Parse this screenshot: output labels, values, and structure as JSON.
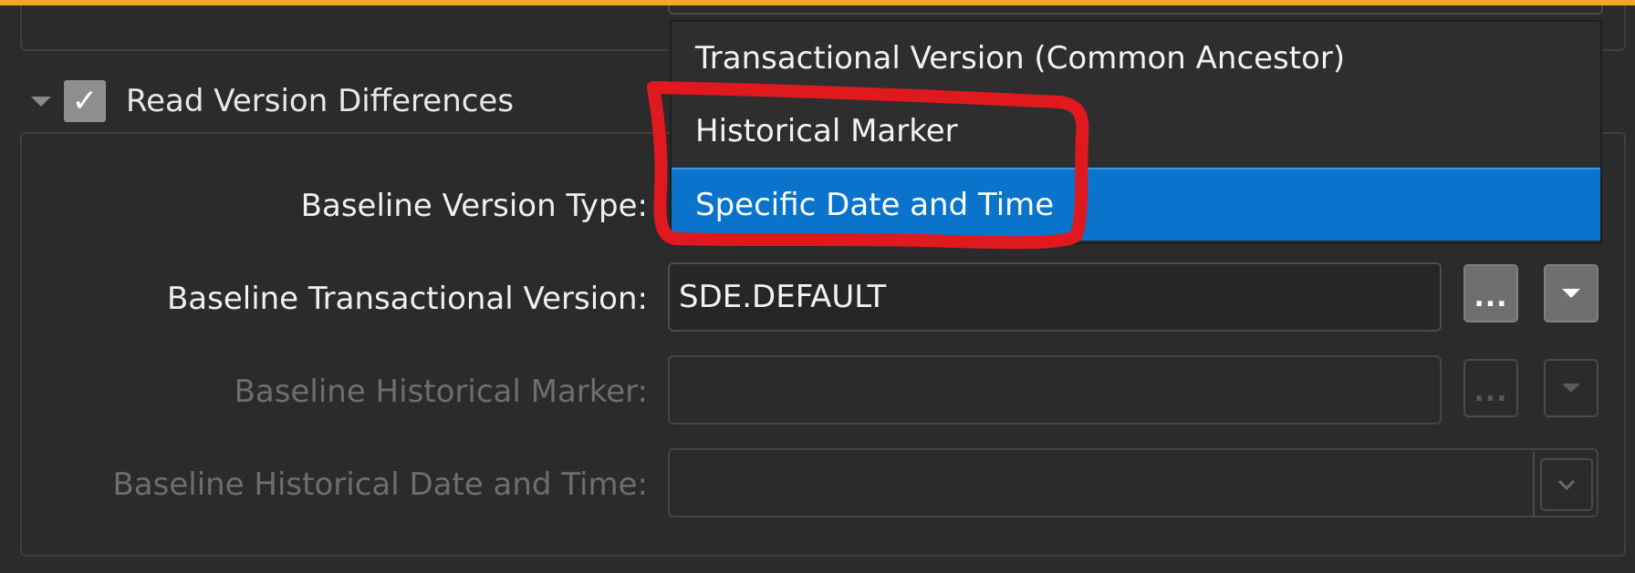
{
  "section": {
    "title": "Read Version Differences",
    "checked": true
  },
  "fields": {
    "baseline_version_type": {
      "label": "Baseline Version Type:"
    },
    "baseline_transactional_version": {
      "label": "Baseline Transactional Version:",
      "value": "SDE.DEFAULT"
    },
    "baseline_historical_marker": {
      "label": "Baseline Historical Marker:",
      "value": ""
    },
    "baseline_historical_datetime": {
      "label": "Baseline Historical Date and Time:",
      "value": ""
    }
  },
  "buttons": {
    "browse_label": "..."
  },
  "dropdown": {
    "options": [
      "Transactional Version (Common Ancestor)",
      "Historical Marker",
      "Specific Date and Time"
    ],
    "selected": "Specific Date and Time"
  },
  "colors": {
    "accent": "#f5a623",
    "selection": "#0a74cc",
    "annotation": "#e0191f"
  }
}
